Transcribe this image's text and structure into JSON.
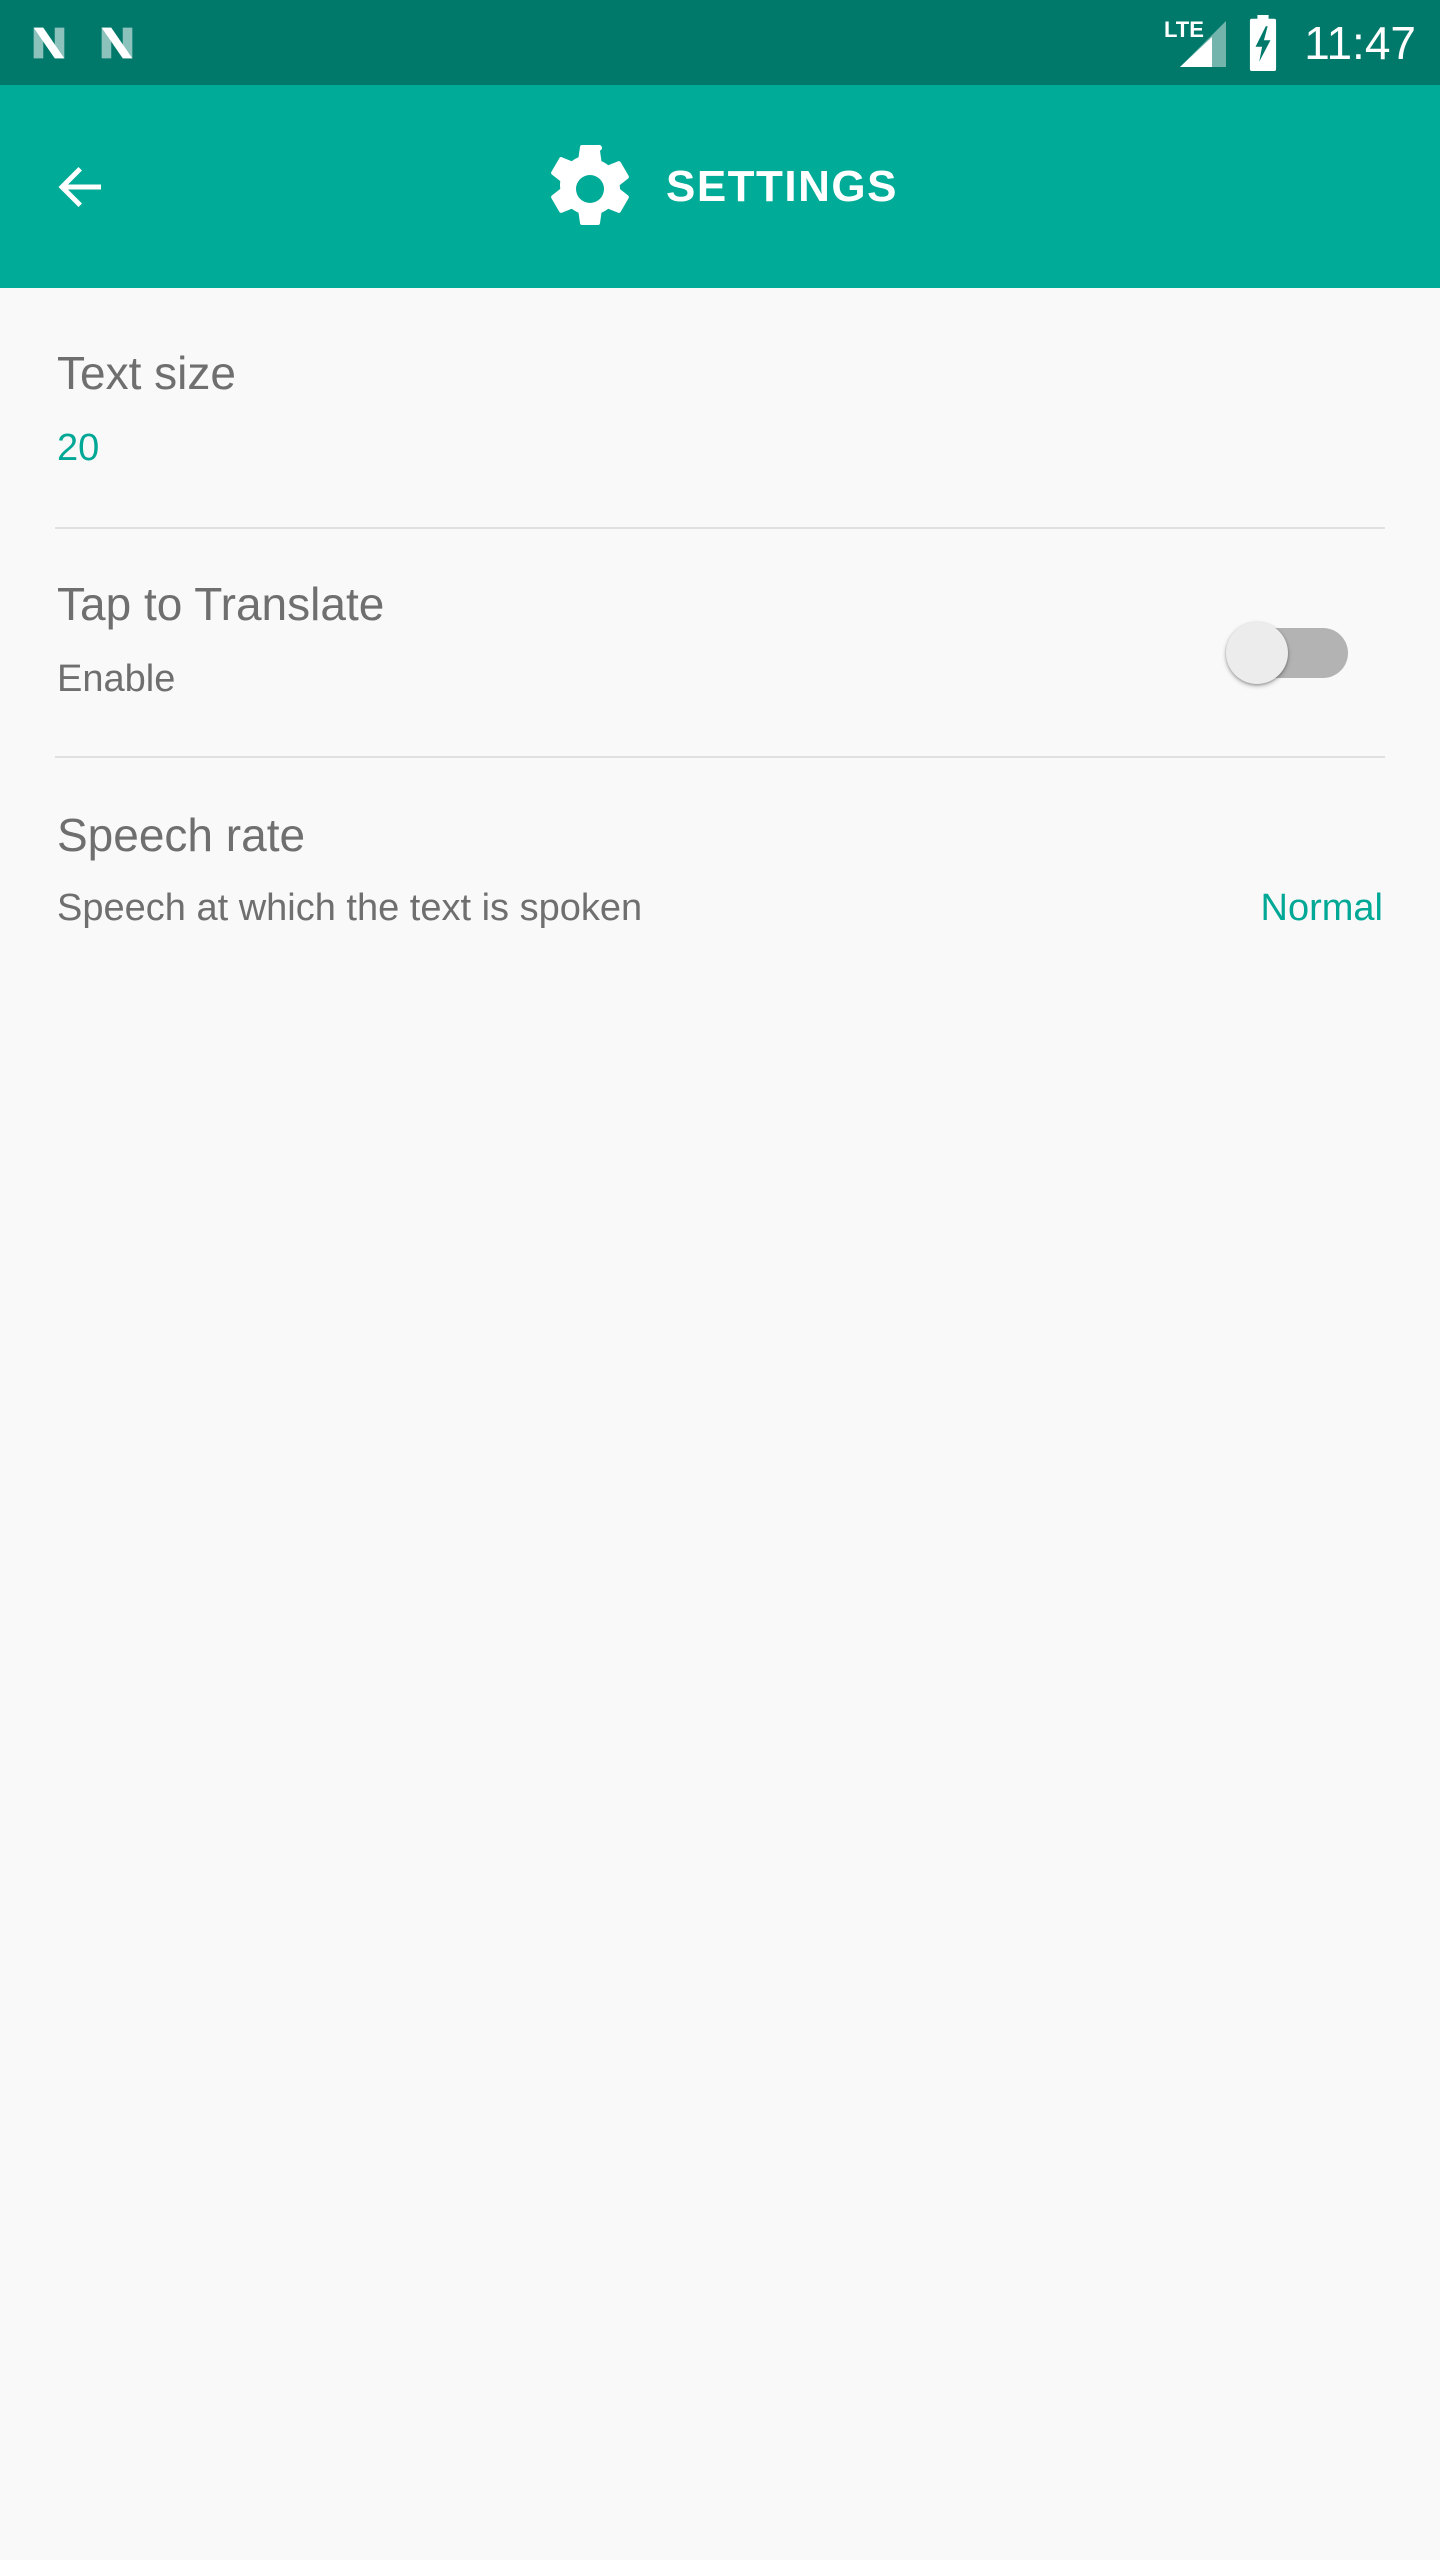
{
  "status_bar": {
    "notifications": [
      {
        "icon": "android-n-notification-icon"
      },
      {
        "icon": "android-n-notification-icon"
      }
    ],
    "network_label": "LTE",
    "signal_icon": "signal-bar-icon",
    "battery_icon": "battery-charging-icon",
    "time": "11:47",
    "background_color": "#00796b",
    "foreground_color": "#ffffff"
  },
  "toolbar": {
    "back_icon": "back-arrow-icon",
    "title_icon": "gear-icon",
    "title": "SETTINGS",
    "background_color": "#00ab97",
    "foreground_color": "#ffffff"
  },
  "settings": {
    "accent_color": "#00a895",
    "text_color": "#6f6f6f",
    "background_color": "#f9f9f9",
    "items": [
      {
        "title": "Text size",
        "value": "20",
        "type": "value-below"
      },
      {
        "title": "Tap to Translate",
        "summary": "Enable",
        "type": "switch",
        "switch_state": "off"
      },
      {
        "title": "Speech rate",
        "summary": "Speech at which the text is spoken",
        "value": "Normal",
        "type": "value-right"
      }
    ]
  }
}
